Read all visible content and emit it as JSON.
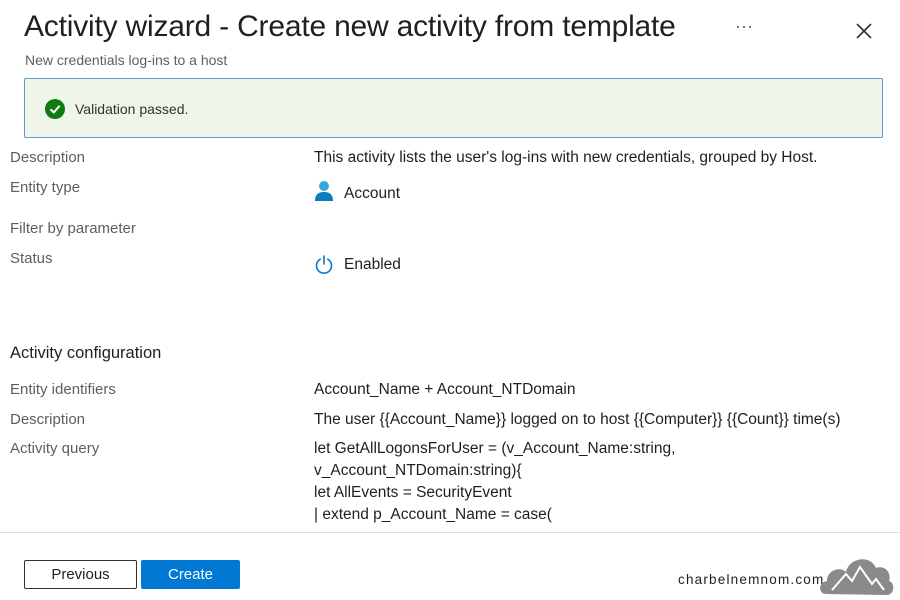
{
  "header": {
    "title": "Activity wizard - Create new activity from template",
    "subtitle": "New credentials log-ins to a host",
    "more_label": "···"
  },
  "banner": {
    "text": "Validation passed.",
    "status_color": "#107c10"
  },
  "details": {
    "description_label": "Description",
    "description_value": "This activity lists the user's log-ins with new credentials, grouped by Host.",
    "entity_type_label": "Entity type",
    "entity_type_value": "Account",
    "entity_type_icon": "account-icon",
    "filter_label": "Filter by parameter",
    "status_label": "Status",
    "status_value": "Enabled",
    "status_icon": "power-icon"
  },
  "configuration": {
    "section_title": "Activity configuration",
    "entity_identifiers_label": "Entity identifiers",
    "entity_identifiers_value": "Account_Name + Account_NTDomain",
    "description_label": "Description",
    "description_value": "The user {{Account_Name}} logged on to host {{Computer}} {{Count}} time(s)",
    "query_label": "Activity query",
    "query_lines": [
      "let GetAllLogonsForUser = (v_Account_Name:string,",
      "v_Account_NTDomain:string){",
      "let AllEvents = SecurityEvent",
      "| extend p_Account_Name = case("
    ]
  },
  "footer": {
    "previous_label": "Previous",
    "create_label": "Create",
    "accent_color": "#0078d4"
  },
  "watermark": {
    "text": "charbelnemnom.com"
  }
}
